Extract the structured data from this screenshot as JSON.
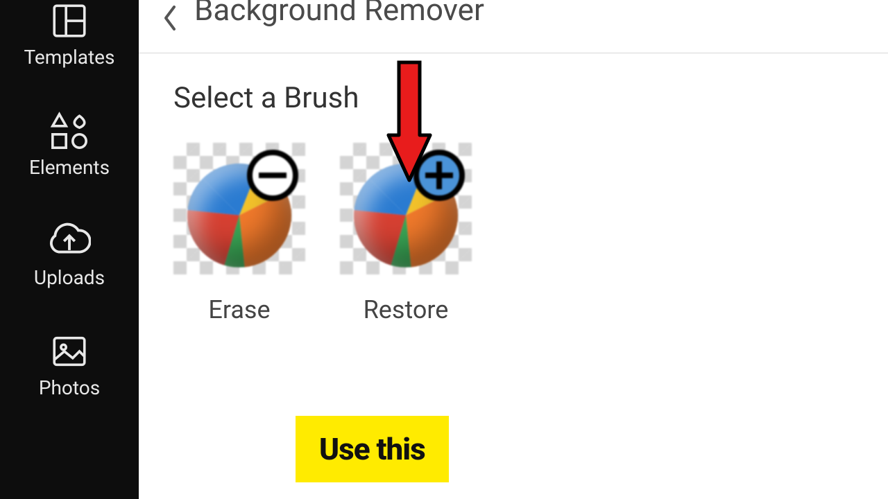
{
  "sidebar": {
    "items": [
      {
        "label": "Templates",
        "icon": "templates"
      },
      {
        "label": "Elements",
        "icon": "elements"
      },
      {
        "label": "Uploads",
        "icon": "uploads"
      },
      {
        "label": "Photos",
        "icon": "photos"
      }
    ]
  },
  "header": {
    "title": "Background Remover"
  },
  "section": {
    "title": "Select a Brush",
    "brushes": [
      {
        "label": "Erase",
        "sign": "minus"
      },
      {
        "label": "Restore",
        "sign": "plus"
      }
    ]
  },
  "annotation": {
    "callout": "Use this"
  }
}
